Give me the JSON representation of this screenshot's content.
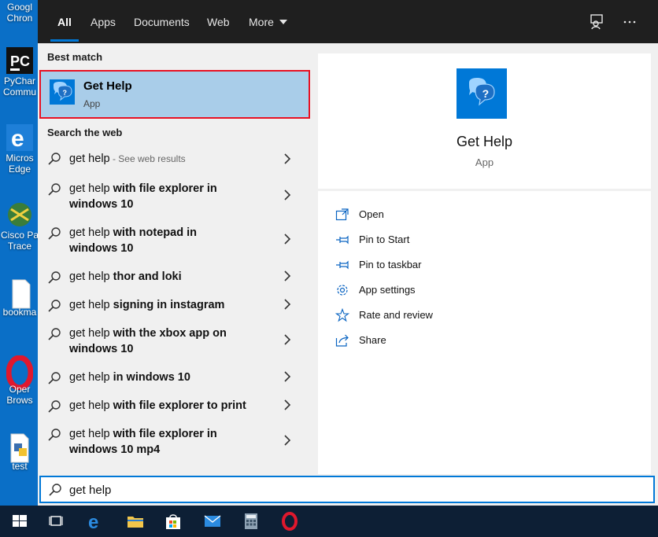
{
  "desktop": {
    "icons": [
      {
        "label1": "Googl",
        "label2": "Chron"
      },
      {
        "label1": "PyChar",
        "label2": "Commu"
      },
      {
        "label1": "Micros",
        "label2": "Edge"
      },
      {
        "label1": "Cisco Pa",
        "label2": "Trace"
      },
      {
        "label1": "bookma",
        "label2": ""
      },
      {
        "label1": "Oper",
        "label2": "Brows"
      },
      {
        "label1": "test",
        "label2": ""
      }
    ]
  },
  "tabs": {
    "all": "All",
    "apps": "Apps",
    "documents": "Documents",
    "web": "Web",
    "more": "More"
  },
  "best_match": {
    "title": "Best match",
    "app_name": "Get Help",
    "app_type": "App"
  },
  "search_web": {
    "title": "Search the web",
    "results": [
      {
        "prefix": "get help",
        "bold": "",
        "hint": " - See web results"
      },
      {
        "prefix": "get help",
        "bold": " with file explorer in windows 10",
        "hint": ""
      },
      {
        "prefix": "get help",
        "bold": " with notepad in windows 10",
        "hint": ""
      },
      {
        "prefix": "get help",
        "bold": " thor and loki",
        "hint": ""
      },
      {
        "prefix": "get help",
        "bold": " signing in instagram",
        "hint": ""
      },
      {
        "prefix": "get help",
        "bold": " with the xbox app on windows 10",
        "hint": ""
      },
      {
        "prefix": "get help",
        "bold": " in windows 10",
        "hint": ""
      },
      {
        "prefix": "get help",
        "bold": " with file explorer to print",
        "hint": ""
      },
      {
        "prefix": "get help",
        "bold": " with file explorer in windows 10 mp4",
        "hint": ""
      }
    ]
  },
  "preview": {
    "app_name": "Get Help",
    "app_type": "App",
    "actions": [
      {
        "label": "Open",
        "icon": "open-icon"
      },
      {
        "label": "Pin to Start",
        "icon": "pin-icon"
      },
      {
        "label": "Pin to taskbar",
        "icon": "pin-icon"
      },
      {
        "label": "App settings",
        "icon": "gear-icon"
      },
      {
        "label": "Rate and review",
        "icon": "star-icon"
      },
      {
        "label": "Share",
        "icon": "share-icon"
      }
    ]
  },
  "search": {
    "query": "get help"
  },
  "colors": {
    "accent": "#0078d7",
    "highlight": "#a9cde9",
    "selection_border": "#e81123"
  }
}
